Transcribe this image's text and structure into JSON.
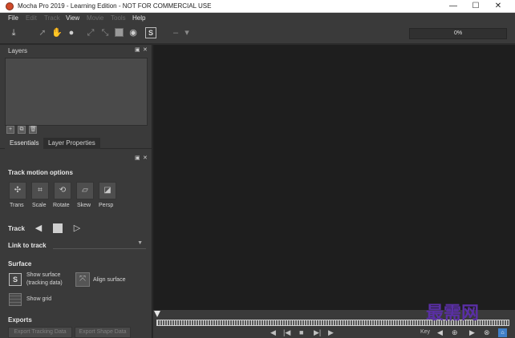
{
  "window": {
    "title": "Mocha Pro 2019 - Learning Edition - NOT FOR COMMERCIAL USE",
    "controls": {
      "minimize": "—",
      "maximize": "☐",
      "close": "✕"
    }
  },
  "menu": [
    {
      "label": "File",
      "enabled": true
    },
    {
      "label": "Edit",
      "enabled": false
    },
    {
      "label": "Track",
      "enabled": false
    },
    {
      "label": "View",
      "enabled": true
    },
    {
      "label": "Movie",
      "enabled": false
    },
    {
      "label": "Tools",
      "enabled": false
    },
    {
      "label": "Help",
      "enabled": true
    }
  ],
  "toolbar": {
    "progress_text": "0%",
    "icons": [
      "import-icon",
      "select-icon",
      "hand-icon",
      "circle-icon",
      "transform-icon",
      "link-icon",
      "surface-icon",
      "record-icon",
      "s-icon",
      "dropdown-icon"
    ]
  },
  "layers_panel": {
    "title": "Layers",
    "controls": {
      "float": "▣",
      "close": "✕"
    }
  },
  "tabs": [
    {
      "label": "Essentials",
      "active": true
    },
    {
      "label": "Layer Properties",
      "active": false
    }
  ],
  "essentials": {
    "controls": {
      "float": "▣",
      "close": "✕"
    },
    "track_motion_title": "Track motion options",
    "motion_options": [
      {
        "label": "Trans",
        "icon": "✣"
      },
      {
        "label": "Scale",
        "icon": "⌗"
      },
      {
        "label": "Rotate",
        "icon": "⟲"
      },
      {
        "label": "Skew",
        "icon": "▱"
      },
      {
        "label": "Persp",
        "icon": "◪"
      }
    ],
    "track": {
      "label": "Track",
      "back_icon": "◀",
      "forward_icon": "▷"
    },
    "link_to_track": {
      "label": "Link to track",
      "value": "",
      "arrow": "▼"
    },
    "surface": {
      "title": "Surface",
      "show_surface_line1": "Show surface",
      "show_surface_line2": "(tracking data)",
      "align_surface": "Align surface",
      "show_grid": "Show grid",
      "s_glyph": "S"
    },
    "exports": {
      "title": "Exports",
      "export_tracking": "Export Tracking Data",
      "export_shape": "Export Shape Data"
    }
  },
  "timeline": {
    "key_label": "Key",
    "transport_icons": [
      "◀",
      "|◀",
      "■",
      "▶|",
      "▶"
    ],
    "key_icons": [
      "◀",
      "⊕",
      "▶",
      "⊗"
    ],
    "home_icon": "⌂"
  },
  "watermark": "最需网"
}
